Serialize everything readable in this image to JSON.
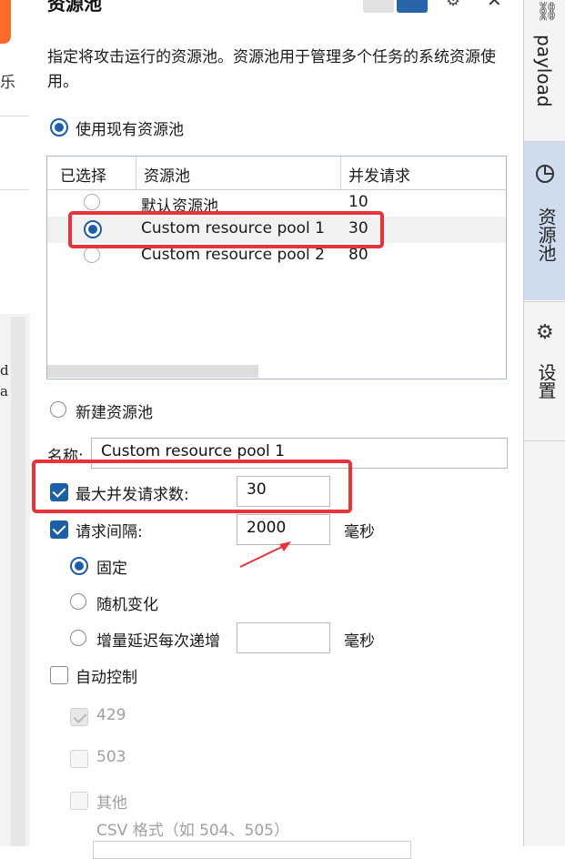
{
  "left": {
    "fragment_1": "乐",
    "fragment_2": "d\na"
  },
  "panel": {
    "title": "资源池",
    "description": "指定将攻击运行的资源池。资源池用于管理多个任务的系统资源使用。",
    "use_existing_label": "使用现有资源池",
    "table": {
      "columns": [
        "已选择",
        "资源池",
        "并发请求"
      ],
      "rows": [
        {
          "selected": false,
          "name": "默认资源池",
          "concurrency": "10"
        },
        {
          "selected": true,
          "name": "Custom resource pool 1",
          "concurrency": "30"
        },
        {
          "selected": false,
          "name": "Custom resource pool 2",
          "concurrency": "80"
        }
      ]
    },
    "new_pool_label": "新建资源池",
    "name_label": "名称:",
    "name_value": "Custom resource pool 1",
    "max_concurrent_label": "最大并发请求数:",
    "max_concurrent_value": "30",
    "max_concurrent_checked": true,
    "request_interval_label": "请求间隔:",
    "request_interval_value": "2000",
    "request_interval_checked": true,
    "ms_unit": "毫秒",
    "interval_fixed": "固定",
    "interval_random": "随机变化",
    "interval_incremental": "增量延迟每次递增",
    "incremental_value": "",
    "auto_control_label": "自动控制",
    "auto_control_checked": false,
    "codes": [
      "429",
      "503",
      "其他"
    ],
    "csv_hint": "CSV 格式（如 504、505）"
  },
  "sidebar": {
    "tabs": [
      {
        "label": "payload",
        "icon": "link-icon"
      },
      {
        "label": "资源池",
        "icon": "pie-chart-icon",
        "active": true
      },
      {
        "label": "设置",
        "icon": "gear-icon"
      }
    ]
  },
  "colors": {
    "accent": "#1d5fa6",
    "highlight": "#e8333a",
    "active_tab": "#cfdcee"
  }
}
